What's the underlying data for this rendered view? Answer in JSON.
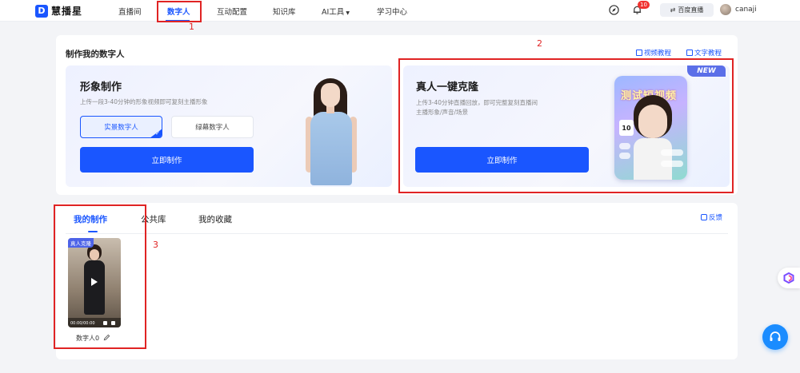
{
  "nav": {
    "logo_text": "慧播星",
    "logo_mark": "D",
    "items": [
      "直播间",
      "数字人",
      "互动配置",
      "知识库",
      "AI工具",
      "学习中心"
    ],
    "active_index": 1,
    "notifications": "10",
    "switch_label": "百度直播",
    "username": "canaji"
  },
  "top": {
    "section_title": "制作我的数字人",
    "video_tutorial": "视频教程",
    "text_tutorial": "文字教程",
    "left_panel": {
      "title": "形象制作",
      "desc": "上传一段3-40分钟的形象视频即可复刻主播形象",
      "option_selected": "实景数字人",
      "option_other": "绿幕数字人",
      "button": "立即制作"
    },
    "right_panel": {
      "title": "真人一键克隆",
      "desc_line1": "上传3-40分钟直播回放，即可完整复刻直播间",
      "desc_line2": "主播形象/声音/场景",
      "button": "立即制作",
      "new_badge": "NEW",
      "phone_title": "测试短视频",
      "phone_number": "10"
    }
  },
  "bottom": {
    "tabs": [
      "我的制作",
      "公共库",
      "我的收藏"
    ],
    "active_tab": 0,
    "feedback": "反馈",
    "video": {
      "tag": "真人克隆",
      "time": "00:00/00:00",
      "name": "数字人0"
    }
  },
  "annotations": [
    "1",
    "2",
    "3"
  ],
  "colors": {
    "accent": "#1a56ff",
    "annotation": "#e02424",
    "background": "#f3f4f7"
  }
}
